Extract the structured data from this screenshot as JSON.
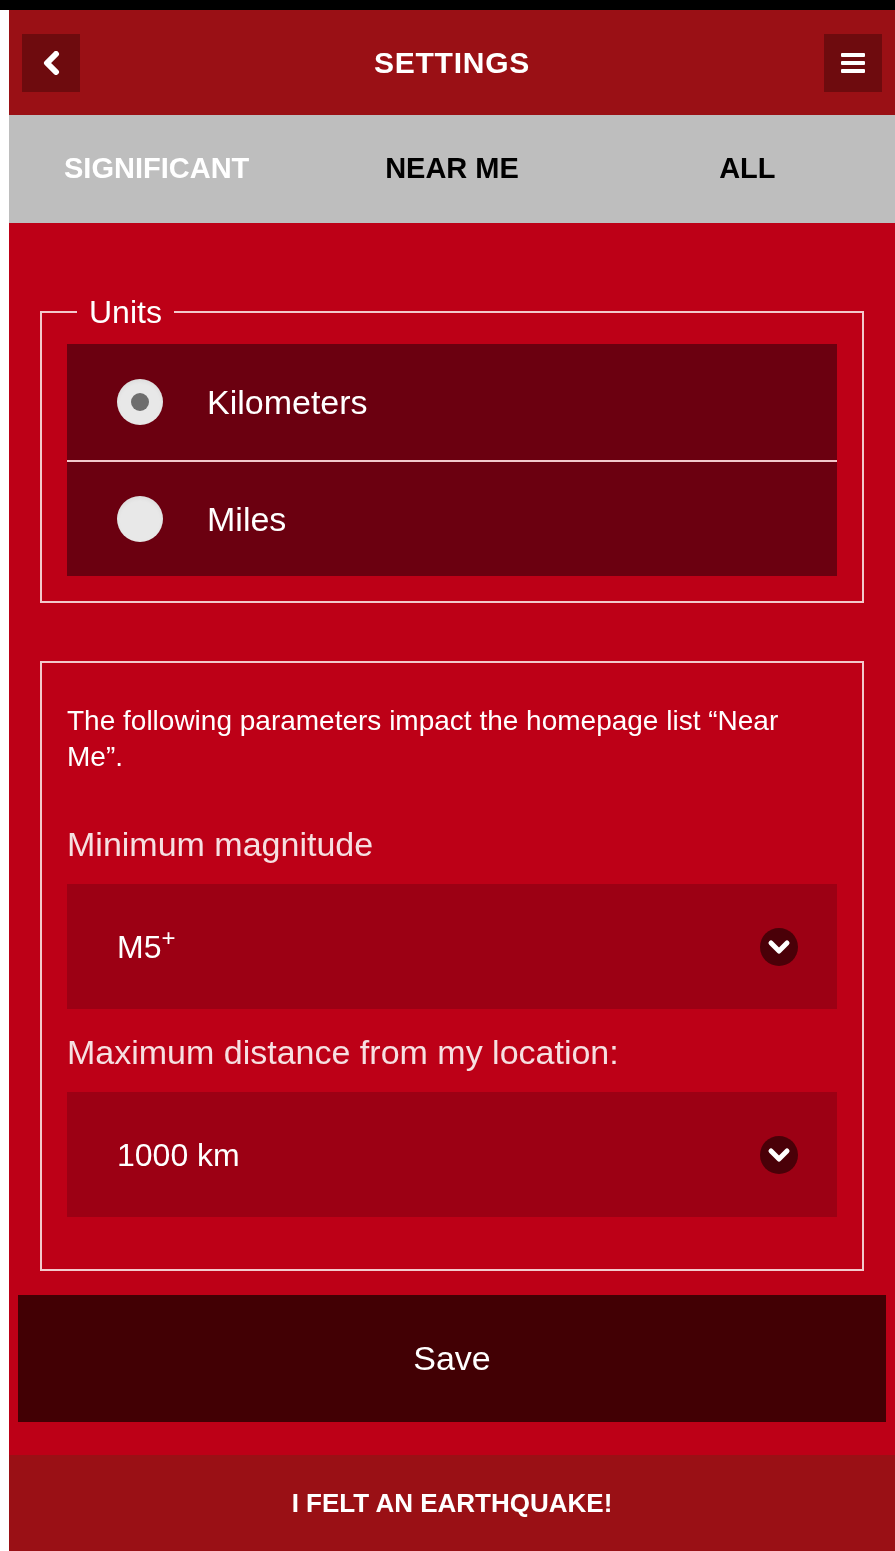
{
  "header": {
    "title": "SETTINGS"
  },
  "tabs": [
    {
      "label": "SIGNIFICANT",
      "selected": true
    },
    {
      "label": "NEAR ME",
      "selected": false
    },
    {
      "label": "ALL",
      "selected": false
    }
  ],
  "units": {
    "legend": "Units",
    "options": [
      {
        "label": "Kilometers",
        "selected": true
      },
      {
        "label": "Miles",
        "selected": false
      }
    ]
  },
  "near_me": {
    "description": "The following parameters impact the homepage list “Near Me”.",
    "fields": [
      {
        "label": "Minimum magnitude",
        "value": "M5$^{+}$"
      },
      {
        "label": "Maximum distance from my location:",
        "value": "1000 km"
      }
    ]
  },
  "save_button": "Save",
  "footer_button": "I FELT AN EARTHQUAKE!"
}
